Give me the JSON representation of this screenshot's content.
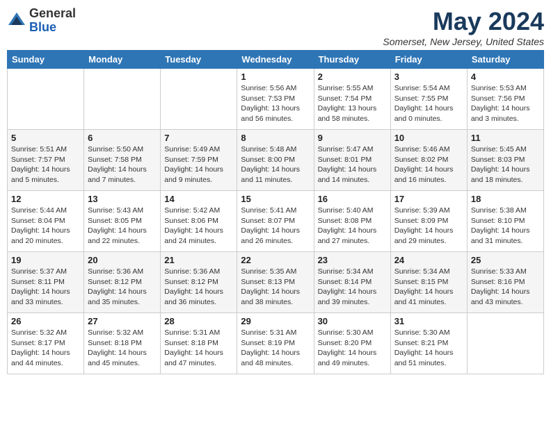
{
  "header": {
    "logo_line1": "General",
    "logo_line2": "Blue",
    "month": "May 2024",
    "location": "Somerset, New Jersey, United States"
  },
  "weekdays": [
    "Sunday",
    "Monday",
    "Tuesday",
    "Wednesday",
    "Thursday",
    "Friday",
    "Saturday"
  ],
  "weeks": [
    [
      {
        "day": "",
        "info": ""
      },
      {
        "day": "",
        "info": ""
      },
      {
        "day": "",
        "info": ""
      },
      {
        "day": "1",
        "info": "Sunrise: 5:56 AM\nSunset: 7:53 PM\nDaylight: 13 hours\nand 56 minutes."
      },
      {
        "day": "2",
        "info": "Sunrise: 5:55 AM\nSunset: 7:54 PM\nDaylight: 13 hours\nand 58 minutes."
      },
      {
        "day": "3",
        "info": "Sunrise: 5:54 AM\nSunset: 7:55 PM\nDaylight: 14 hours\nand 0 minutes."
      },
      {
        "day": "4",
        "info": "Sunrise: 5:53 AM\nSunset: 7:56 PM\nDaylight: 14 hours\nand 3 minutes."
      }
    ],
    [
      {
        "day": "5",
        "info": "Sunrise: 5:51 AM\nSunset: 7:57 PM\nDaylight: 14 hours\nand 5 minutes."
      },
      {
        "day": "6",
        "info": "Sunrise: 5:50 AM\nSunset: 7:58 PM\nDaylight: 14 hours\nand 7 minutes."
      },
      {
        "day": "7",
        "info": "Sunrise: 5:49 AM\nSunset: 7:59 PM\nDaylight: 14 hours\nand 9 minutes."
      },
      {
        "day": "8",
        "info": "Sunrise: 5:48 AM\nSunset: 8:00 PM\nDaylight: 14 hours\nand 11 minutes."
      },
      {
        "day": "9",
        "info": "Sunrise: 5:47 AM\nSunset: 8:01 PM\nDaylight: 14 hours\nand 14 minutes."
      },
      {
        "day": "10",
        "info": "Sunrise: 5:46 AM\nSunset: 8:02 PM\nDaylight: 14 hours\nand 16 minutes."
      },
      {
        "day": "11",
        "info": "Sunrise: 5:45 AM\nSunset: 8:03 PM\nDaylight: 14 hours\nand 18 minutes."
      }
    ],
    [
      {
        "day": "12",
        "info": "Sunrise: 5:44 AM\nSunset: 8:04 PM\nDaylight: 14 hours\nand 20 minutes."
      },
      {
        "day": "13",
        "info": "Sunrise: 5:43 AM\nSunset: 8:05 PM\nDaylight: 14 hours\nand 22 minutes."
      },
      {
        "day": "14",
        "info": "Sunrise: 5:42 AM\nSunset: 8:06 PM\nDaylight: 14 hours\nand 24 minutes."
      },
      {
        "day": "15",
        "info": "Sunrise: 5:41 AM\nSunset: 8:07 PM\nDaylight: 14 hours\nand 26 minutes."
      },
      {
        "day": "16",
        "info": "Sunrise: 5:40 AM\nSunset: 8:08 PM\nDaylight: 14 hours\nand 27 minutes."
      },
      {
        "day": "17",
        "info": "Sunrise: 5:39 AM\nSunset: 8:09 PM\nDaylight: 14 hours\nand 29 minutes."
      },
      {
        "day": "18",
        "info": "Sunrise: 5:38 AM\nSunset: 8:10 PM\nDaylight: 14 hours\nand 31 minutes."
      }
    ],
    [
      {
        "day": "19",
        "info": "Sunrise: 5:37 AM\nSunset: 8:11 PM\nDaylight: 14 hours\nand 33 minutes."
      },
      {
        "day": "20",
        "info": "Sunrise: 5:36 AM\nSunset: 8:12 PM\nDaylight: 14 hours\nand 35 minutes."
      },
      {
        "day": "21",
        "info": "Sunrise: 5:36 AM\nSunset: 8:12 PM\nDaylight: 14 hours\nand 36 minutes."
      },
      {
        "day": "22",
        "info": "Sunrise: 5:35 AM\nSunset: 8:13 PM\nDaylight: 14 hours\nand 38 minutes."
      },
      {
        "day": "23",
        "info": "Sunrise: 5:34 AM\nSunset: 8:14 PM\nDaylight: 14 hours\nand 39 minutes."
      },
      {
        "day": "24",
        "info": "Sunrise: 5:34 AM\nSunset: 8:15 PM\nDaylight: 14 hours\nand 41 minutes."
      },
      {
        "day": "25",
        "info": "Sunrise: 5:33 AM\nSunset: 8:16 PM\nDaylight: 14 hours\nand 43 minutes."
      }
    ],
    [
      {
        "day": "26",
        "info": "Sunrise: 5:32 AM\nSunset: 8:17 PM\nDaylight: 14 hours\nand 44 minutes."
      },
      {
        "day": "27",
        "info": "Sunrise: 5:32 AM\nSunset: 8:18 PM\nDaylight: 14 hours\nand 45 minutes."
      },
      {
        "day": "28",
        "info": "Sunrise: 5:31 AM\nSunset: 8:18 PM\nDaylight: 14 hours\nand 47 minutes."
      },
      {
        "day": "29",
        "info": "Sunrise: 5:31 AM\nSunset: 8:19 PM\nDaylight: 14 hours\nand 48 minutes."
      },
      {
        "day": "30",
        "info": "Sunrise: 5:30 AM\nSunset: 8:20 PM\nDaylight: 14 hours\nand 49 minutes."
      },
      {
        "day": "31",
        "info": "Sunrise: 5:30 AM\nSunset: 8:21 PM\nDaylight: 14 hours\nand 51 minutes."
      },
      {
        "day": "",
        "info": ""
      }
    ]
  ]
}
